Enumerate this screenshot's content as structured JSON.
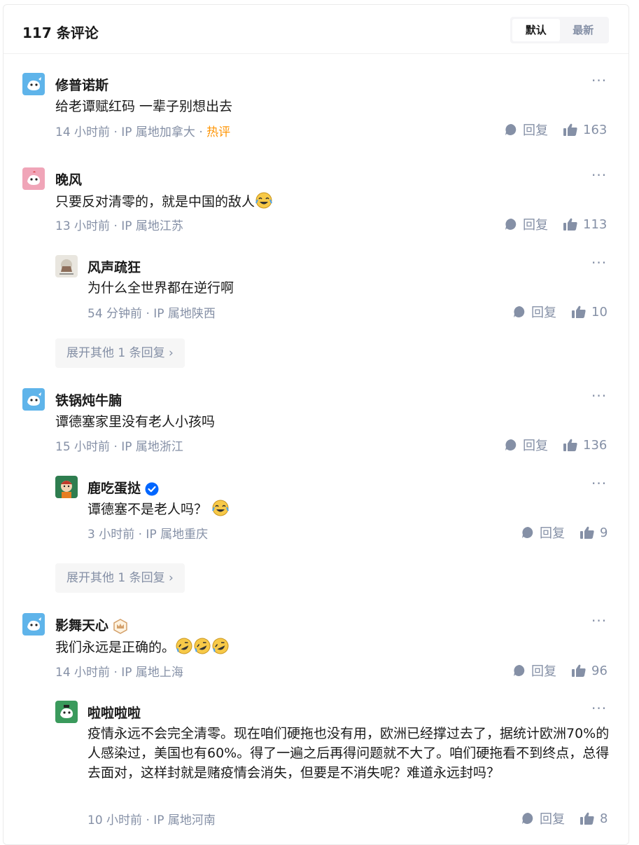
{
  "header": {
    "title": "117 条评论",
    "sort_default": "默认",
    "sort_latest": "最新"
  },
  "comments": [
    {
      "name": "修普诺斯",
      "text": "给老谭赋红码 一辈子别想出去",
      "meta": "14 小时前 · IP 属地加拿大 · ",
      "hot": "热评",
      "reply": "回复",
      "likes": "163",
      "avatar": "blue-bird-avatar"
    },
    {
      "name": "晚风",
      "text": "只要反对清零的，就是中国的敌人",
      "meta": "13 小时前 · IP 属地江苏",
      "reply": "回复",
      "likes": "113",
      "avatar": "pink-bird-avatar"
    },
    {
      "name": "风声疏狂",
      "text": "为什么全世界都在逆行啊",
      "meta": "54 分钟前 · IP 属地陕西",
      "reply": "回复",
      "likes": "10",
      "avatar": "sketch-avatar"
    },
    {
      "name": "铁锅炖牛腩",
      "text": "谭德塞家里没有老人小孩吗",
      "meta": "15 小时前 · IP 属地浙江",
      "reply": "回复",
      "likes": "136",
      "avatar": "blue-bird-avatar"
    },
    {
      "name": "鹿吃蛋挞",
      "text": "谭德塞不是老人吗？",
      "meta": "3 小时前 · IP 属地重庆",
      "reply": "回复",
      "likes": "9",
      "avatar": "cartoon-avatar"
    },
    {
      "name": "影舞天心",
      "text": "我们永远是正确的。",
      "meta": "14 小时前 · IP 属地上海",
      "reply": "回复",
      "likes": "96",
      "avatar": "blue-bird-avatar"
    },
    {
      "name": "啦啦啦啦",
      "text": "疫情永远不会完全清零。现在咱们硬拖也没有用，欧洲已经撑过去了，据统计欧洲70%的人感染过，美国也有60%。得了一遍之后再得问题就不大了。咱们硬拖看不到终点，总得去面对，这样封就是赌疫情会消失，但要是不消失呢？难道永远封吗？",
      "meta": "10 小时前 · IP 属地河南",
      "reply": "回复",
      "likes": "8",
      "avatar": "green-bird-avatar"
    }
  ],
  "expand": {
    "label1": "展开其他 1 条回复",
    "label2": "展开其他 1 条回复"
  },
  "colors": {
    "meta": "#8590a6",
    "hot": "#ff9607",
    "verified": "#0066ff"
  }
}
